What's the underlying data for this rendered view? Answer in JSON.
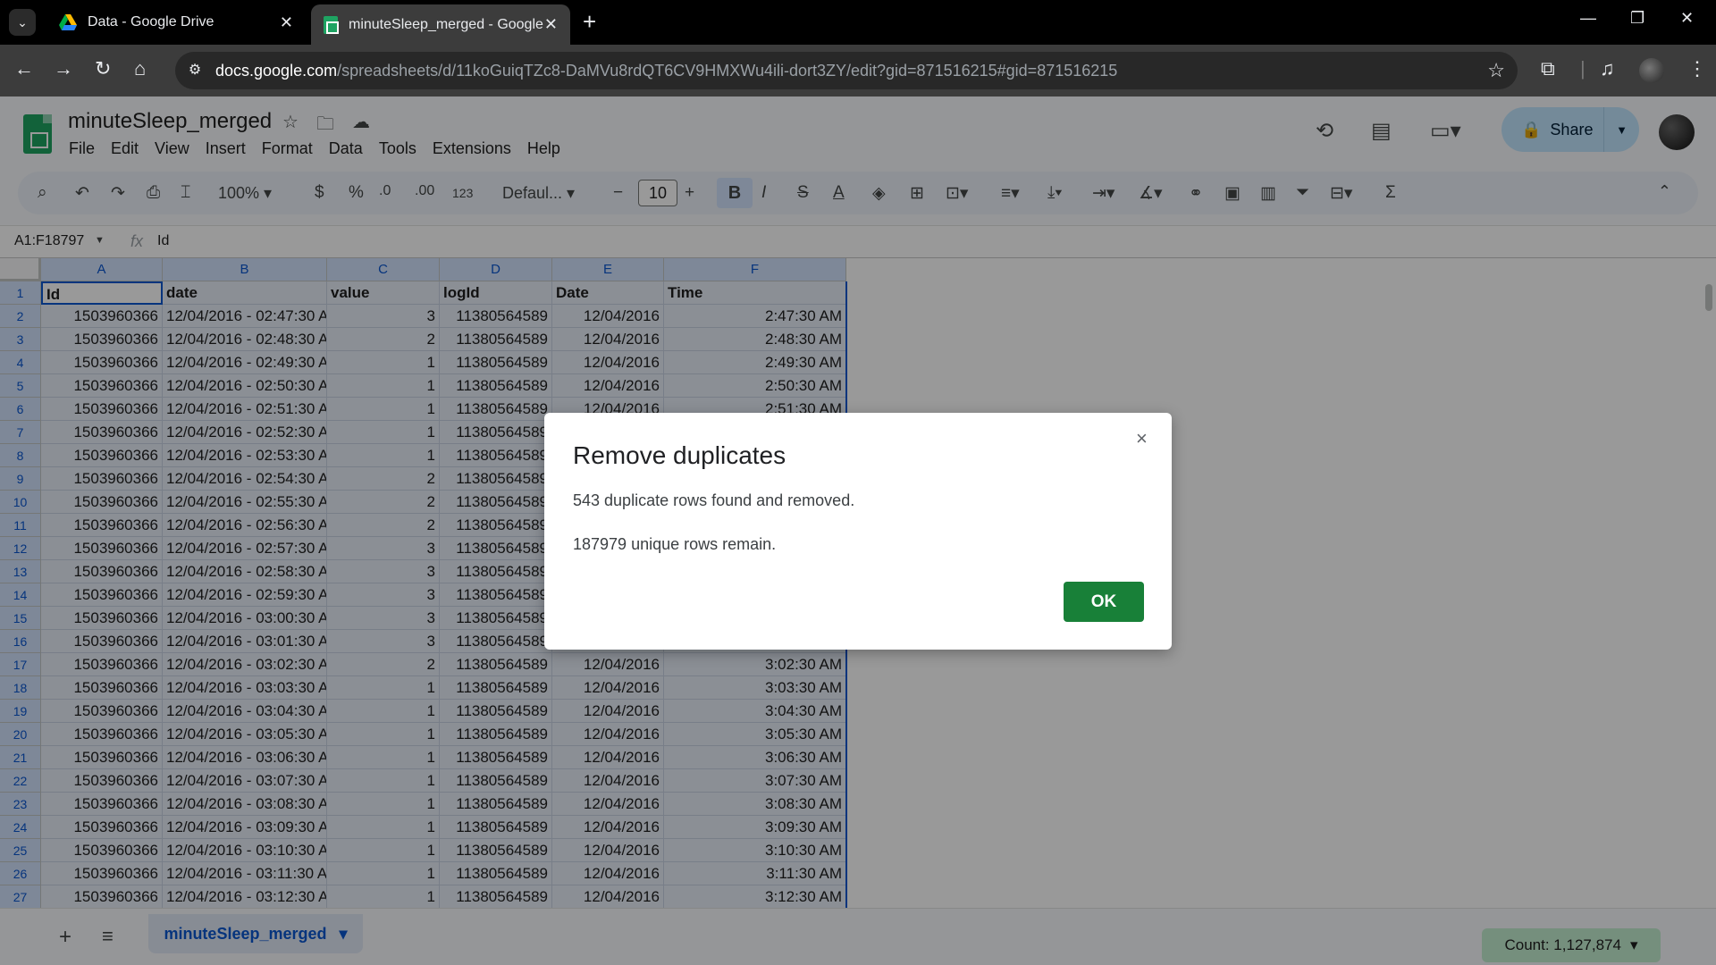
{
  "browser": {
    "tabs": [
      {
        "title": "Data - Google Drive",
        "icon": "google-drive-icon"
      },
      {
        "title": "minuteSleep_merged - Google",
        "icon": "google-sheets-icon"
      }
    ],
    "url_host": "docs.google.com",
    "url_path": "/spreadsheets/d/11koGuiqTZc8-DaMVu8rdQT6CV9HMXWu4ili-dort3ZY/edit?gid=871516215#gid=871516215"
  },
  "sheets": {
    "title": "minuteSleep_merged",
    "menu": [
      "File",
      "Edit",
      "View",
      "Insert",
      "Format",
      "Data",
      "Tools",
      "Extensions",
      "Help"
    ],
    "share_label": "Share",
    "toolbar": {
      "zoom": "100%",
      "currency": "$",
      "percent": "%",
      "dec_decrease": ".0",
      "dec_increase": ".00",
      "number_format": "123",
      "font": "Defaul...",
      "font_size": "10",
      "bold": "B",
      "italic": "I",
      "strike": "S",
      "text_color": "A"
    },
    "name_box": "A1:F18797",
    "fx_symbol": "fx",
    "formula_value": "Id"
  },
  "grid": {
    "columns": [
      "A",
      "B",
      "C",
      "D",
      "E",
      "F"
    ],
    "header_row": [
      "Id",
      "date",
      "value",
      "logId",
      "Date",
      "Time"
    ],
    "rows": [
      [
        "1503960366",
        "12/04/2016 - 02:47:30 A",
        "3",
        "11380564589",
        "12/04/2016",
        "2:47:30 AM"
      ],
      [
        "1503960366",
        "12/04/2016 - 02:48:30 A",
        "2",
        "11380564589",
        "12/04/2016",
        "2:48:30 AM"
      ],
      [
        "1503960366",
        "12/04/2016 - 02:49:30 A",
        "1",
        "11380564589",
        "12/04/2016",
        "2:49:30 AM"
      ],
      [
        "1503960366",
        "12/04/2016 - 02:50:30 A",
        "1",
        "11380564589",
        "12/04/2016",
        "2:50:30 AM"
      ],
      [
        "1503960366",
        "12/04/2016 - 02:51:30 A",
        "1",
        "11380564589",
        "12/04/2016",
        "2:51:30 AM"
      ],
      [
        "1503960366",
        "12/04/2016 - 02:52:30 A",
        "1",
        "11380564589",
        "",
        ""
      ],
      [
        "1503960366",
        "12/04/2016 - 02:53:30 A",
        "1",
        "11380564589",
        "",
        ""
      ],
      [
        "1503960366",
        "12/04/2016 - 02:54:30 A",
        "2",
        "11380564589",
        "",
        ""
      ],
      [
        "1503960366",
        "12/04/2016 - 02:55:30 A",
        "2",
        "11380564589",
        "",
        ""
      ],
      [
        "1503960366",
        "12/04/2016 - 02:56:30 A",
        "2",
        "11380564589",
        "",
        ""
      ],
      [
        "1503960366",
        "12/04/2016 - 02:57:30 A",
        "3",
        "11380564589",
        "",
        ""
      ],
      [
        "1503960366",
        "12/04/2016 - 02:58:30 A",
        "3",
        "11380564589",
        "",
        ""
      ],
      [
        "1503960366",
        "12/04/2016 - 02:59:30 A",
        "3",
        "11380564589",
        "",
        ""
      ],
      [
        "1503960366",
        "12/04/2016 - 03:00:30 A",
        "3",
        "11380564589",
        "",
        ""
      ],
      [
        "1503960366",
        "12/04/2016 - 03:01:30 A",
        "3",
        "11380564589",
        "",
        ""
      ],
      [
        "1503960366",
        "12/04/2016 - 03:02:30 A",
        "2",
        "11380564589",
        "12/04/2016",
        "3:02:30 AM"
      ],
      [
        "1503960366",
        "12/04/2016 - 03:03:30 A",
        "1",
        "11380564589",
        "12/04/2016",
        "3:03:30 AM"
      ],
      [
        "1503960366",
        "12/04/2016 - 03:04:30 A",
        "1",
        "11380564589",
        "12/04/2016",
        "3:04:30 AM"
      ],
      [
        "1503960366",
        "12/04/2016 - 03:05:30 A",
        "1",
        "11380564589",
        "12/04/2016",
        "3:05:30 AM"
      ],
      [
        "1503960366",
        "12/04/2016 - 03:06:30 A",
        "1",
        "11380564589",
        "12/04/2016",
        "3:06:30 AM"
      ],
      [
        "1503960366",
        "12/04/2016 - 03:07:30 A",
        "1",
        "11380564589",
        "12/04/2016",
        "3:07:30 AM"
      ],
      [
        "1503960366",
        "12/04/2016 - 03:08:30 A",
        "1",
        "11380564589",
        "12/04/2016",
        "3:08:30 AM"
      ],
      [
        "1503960366",
        "12/04/2016 - 03:09:30 A",
        "1",
        "11380564589",
        "12/04/2016",
        "3:09:30 AM"
      ],
      [
        "1503960366",
        "12/04/2016 - 03:10:30 A",
        "1",
        "11380564589",
        "12/04/2016",
        "3:10:30 AM"
      ],
      [
        "1503960366",
        "12/04/2016 - 03:11:30 A",
        "1",
        "11380564589",
        "12/04/2016",
        "3:11:30 AM"
      ],
      [
        "1503960366",
        "12/04/2016 - 03:12:30 A",
        "1",
        "11380564589",
        "12/04/2016",
        "3:12:30 AM"
      ]
    ]
  },
  "bottom": {
    "sheet_name": "minuteSleep_merged",
    "count": "Count: 1,127,874"
  },
  "dialog": {
    "title": "Remove duplicates",
    "line1": "543 duplicate rows found and removed.",
    "line2": "187979 unique rows remain.",
    "ok_label": "OK",
    "close_symbol": "×"
  },
  "colors": {
    "accent": "#0b57d0",
    "ok_button": "#188038",
    "selection": "#d3e3fd"
  }
}
